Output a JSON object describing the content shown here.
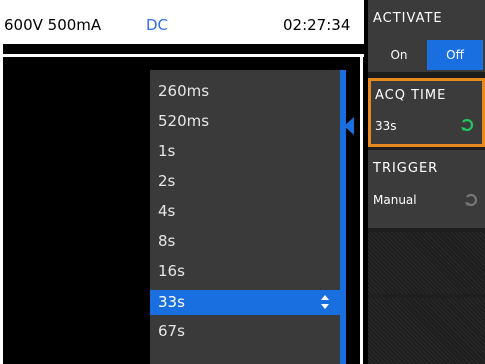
{
  "status_bar": {
    "range": "600V 500mA",
    "mode": "DC",
    "time": "02:27:34"
  },
  "dropdown": {
    "items": [
      "260ms",
      "520ms",
      "1s",
      "2s",
      "4s",
      "8s",
      "16s",
      "33s",
      "67s"
    ],
    "selected": "33s"
  },
  "softkeys": {
    "activate": {
      "title": "ACTIVATE",
      "on_label": "On",
      "off_label": "Off",
      "active": "Off"
    },
    "acq_time": {
      "title": "ACQ TIME",
      "value": "33s"
    },
    "trigger": {
      "title": "TRIGGER",
      "value": "Manual"
    }
  },
  "colors": {
    "accent_blue": "#1a6fe0",
    "focus_orange": "#e8891d",
    "knob_green": "#22c55e",
    "knob_grey": "#777777"
  },
  "icons": {
    "updown": "updown-arrows-icon",
    "pointer": "pointer-left-icon",
    "knob": "rotary-knob-icon"
  }
}
